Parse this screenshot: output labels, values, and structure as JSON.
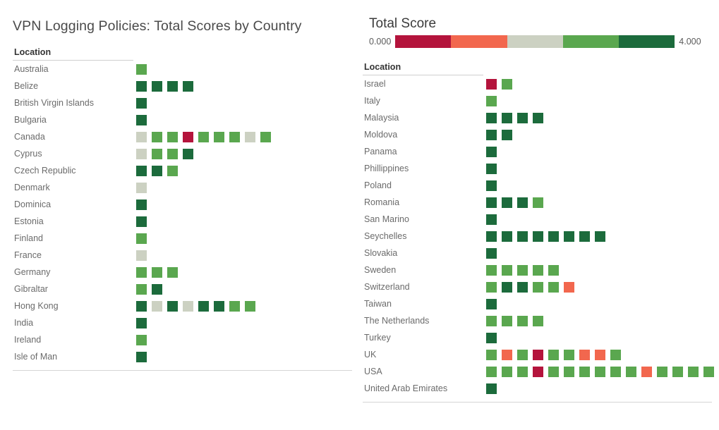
{
  "title": "VPN Logging Policies: Total Scores by Country",
  "legend": {
    "title": "Total Score",
    "min_label": "0.000",
    "max_label": "4.000",
    "bands": [
      "#b4143c",
      "#f2674e",
      "#ccd1c2",
      "#5aa74f",
      "#1c6b3c"
    ]
  },
  "colors": {
    "crimson": "#b4143c",
    "salmon": "#f2674e",
    "gray": "#ccd1c2",
    "green": "#5aa74f",
    "dark_green": "#1c6b3c"
  },
  "left_table": {
    "column_header": "Location",
    "rows": [
      {
        "location": "Australia",
        "marks": [
          "green"
        ]
      },
      {
        "location": "Belize",
        "marks": [
          "dark_green",
          "dark_green",
          "dark_green",
          "dark_green"
        ]
      },
      {
        "location": "British Virgin Islands",
        "marks": [
          "dark_green"
        ]
      },
      {
        "location": "Bulgaria",
        "marks": [
          "dark_green"
        ]
      },
      {
        "location": "Canada",
        "marks": [
          "gray",
          "green",
          "green",
          "crimson",
          "green",
          "green",
          "green",
          "gray",
          "green"
        ]
      },
      {
        "location": "Cyprus",
        "marks": [
          "gray",
          "green",
          "green",
          "dark_green"
        ]
      },
      {
        "location": "Czech Republic",
        "marks": [
          "dark_green",
          "dark_green",
          "green"
        ]
      },
      {
        "location": "Denmark",
        "marks": [
          "gray"
        ]
      },
      {
        "location": "Dominica",
        "marks": [
          "dark_green"
        ]
      },
      {
        "location": "Estonia",
        "marks": [
          "dark_green"
        ]
      },
      {
        "location": "Finland",
        "marks": [
          "green"
        ]
      },
      {
        "location": "France",
        "marks": [
          "gray"
        ]
      },
      {
        "location": "Germany",
        "marks": [
          "green",
          "green",
          "green"
        ]
      },
      {
        "location": "Gibraltar",
        "marks": [
          "green",
          "dark_green"
        ]
      },
      {
        "location": "Hong Kong",
        "marks": [
          "dark_green",
          "gray",
          "dark_green",
          "gray",
          "dark_green",
          "dark_green",
          "green",
          "green"
        ]
      },
      {
        "location": "India",
        "marks": [
          "dark_green"
        ]
      },
      {
        "location": "Ireland",
        "marks": [
          "green"
        ]
      },
      {
        "location": "Isle of Man",
        "marks": [
          "dark_green"
        ]
      }
    ]
  },
  "right_table": {
    "column_header": "Location",
    "rows": [
      {
        "location": "Israel",
        "marks": [
          "crimson",
          "green"
        ]
      },
      {
        "location": "Italy",
        "marks": [
          "green"
        ]
      },
      {
        "location": "Malaysia",
        "marks": [
          "dark_green",
          "dark_green",
          "dark_green",
          "dark_green"
        ]
      },
      {
        "location": "Moldova",
        "marks": [
          "dark_green",
          "dark_green"
        ]
      },
      {
        "location": "Panama",
        "marks": [
          "dark_green"
        ]
      },
      {
        "location": "Phillippines",
        "marks": [
          "dark_green"
        ]
      },
      {
        "location": "Poland",
        "marks": [
          "dark_green"
        ]
      },
      {
        "location": "Romania",
        "marks": [
          "dark_green",
          "dark_green",
          "dark_green",
          "green"
        ]
      },
      {
        "location": "San Marino",
        "marks": [
          "dark_green"
        ]
      },
      {
        "location": "Seychelles",
        "marks": [
          "dark_green",
          "dark_green",
          "dark_green",
          "dark_green",
          "dark_green",
          "dark_green",
          "dark_green",
          "dark_green"
        ]
      },
      {
        "location": "Slovakia",
        "marks": [
          "dark_green"
        ]
      },
      {
        "location": "Sweden",
        "marks": [
          "green",
          "green",
          "green",
          "green",
          "green"
        ]
      },
      {
        "location": "Switzerland",
        "marks": [
          "green",
          "dark_green",
          "dark_green",
          "green",
          "green",
          "salmon"
        ]
      },
      {
        "location": "Taiwan",
        "marks": [
          "dark_green"
        ]
      },
      {
        "location": "The Netherlands",
        "marks": [
          "green",
          "green",
          "green",
          "green"
        ]
      },
      {
        "location": "Turkey",
        "marks": [
          "dark_green"
        ]
      },
      {
        "location": "UK",
        "marks": [
          "green",
          "salmon",
          "green",
          "crimson",
          "green",
          "green",
          "salmon",
          "salmon",
          "green"
        ]
      },
      {
        "location": "USA",
        "marks": [
          "green",
          "green",
          "green",
          "crimson",
          "green",
          "green",
          "green",
          "green",
          "green",
          "green",
          "salmon",
          "green",
          "green",
          "green",
          "green",
          "salmon",
          "green"
        ],
        "truncated": true,
        "ellipsis": "⋯"
      },
      {
        "location": "United Arab Emirates",
        "marks": [
          "dark_green"
        ]
      }
    ]
  }
}
